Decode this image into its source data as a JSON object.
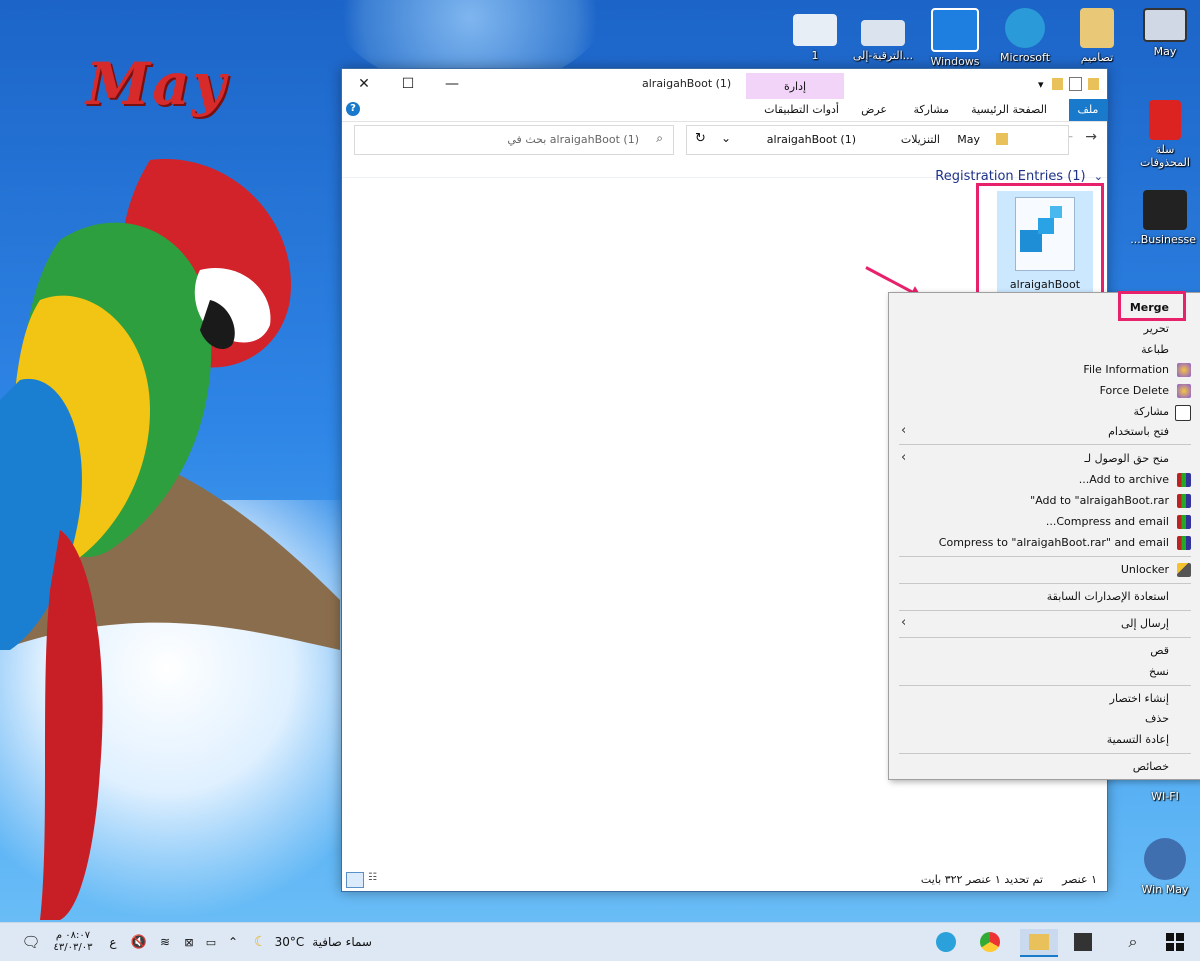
{
  "wallpaper": {
    "logo_text": "May"
  },
  "desktop_icons": [
    {
      "label": "Win May"
    },
    {
      "label": "Businesse..."
    },
    {
      "label": "سلة المحذوفات"
    },
    {
      "label": "May"
    },
    {
      "label": "تصاميم"
    },
    {
      "label": "Microsoft"
    },
    {
      "label": "Windows"
    },
    {
      "label": "...الترقية-إلى"
    },
    {
      "label": "1"
    },
    {
      "label": "WI-FI"
    }
  ],
  "window": {
    "title": "alraigahBoot (1)",
    "context_tab_group": "إدارة",
    "ribbon_tabs": {
      "file": "ملف",
      "home": "الصفحة الرئيسية",
      "share": "مشاركة",
      "view": "عرض",
      "app_tools": "أدوات التطبيقات"
    },
    "address": {
      "crumb1": "May",
      "crumb2": "التنزيلات",
      "crumb3": "alraigahBoot (1)"
    },
    "search_placeholder": "بحث في alraigahBoot (1)",
    "group_header": "Registration Entries (1)",
    "file_name": "alraigahBoot",
    "status": {
      "items": "١ عنصر",
      "selected": "تم تحديد ١ عنصر ٣٢٢ بايت"
    }
  },
  "context_menu": {
    "items": [
      {
        "label": "Merge",
        "bold": true
      },
      {
        "label": "تحرير"
      },
      {
        "label": "طباعة"
      },
      {
        "label": "File Information",
        "icon": "shield-icon"
      },
      {
        "label": "Force Delete",
        "icon": "shield-icon"
      },
      {
        "label": "مشاركة",
        "icon": "share-icon"
      },
      {
        "label": "فتح باستخدام",
        "submenu": true
      },
      {
        "label": "منح حق الوصول لـ",
        "submenu": true
      },
      {
        "label": "Add to archive...",
        "icon": "winrar-icon"
      },
      {
        "label": "Add to \"alraigahBoot.rar\"",
        "icon": "winrar-icon"
      },
      {
        "label": "Compress and email...",
        "icon": "winrar-icon"
      },
      {
        "label": "Compress to \"alraigahBoot.rar\" and email",
        "icon": "winrar-icon"
      },
      {
        "label": "Unlocker",
        "icon": "wand-icon"
      },
      {
        "label": "استعادة الإصدارات السابقة"
      },
      {
        "label": "إرسال إلى",
        "submenu": true
      },
      {
        "label": "قص"
      },
      {
        "label": "نسخ"
      },
      {
        "label": "إنشاء اختصار"
      },
      {
        "label": "حذف"
      },
      {
        "label": "إعادة التسمية"
      },
      {
        "label": "خصائص"
      }
    ]
  },
  "taskbar": {
    "weather_temp": "30°C",
    "weather_text": "سماء صافية",
    "time": "٠٨:٠٧ م",
    "date": "٤٣/٠٣/٠٣",
    "lang": "ع"
  },
  "colors": {
    "accent": "#1979ca",
    "highlight": "#e8216b",
    "selected_item": "#cce8ff"
  }
}
